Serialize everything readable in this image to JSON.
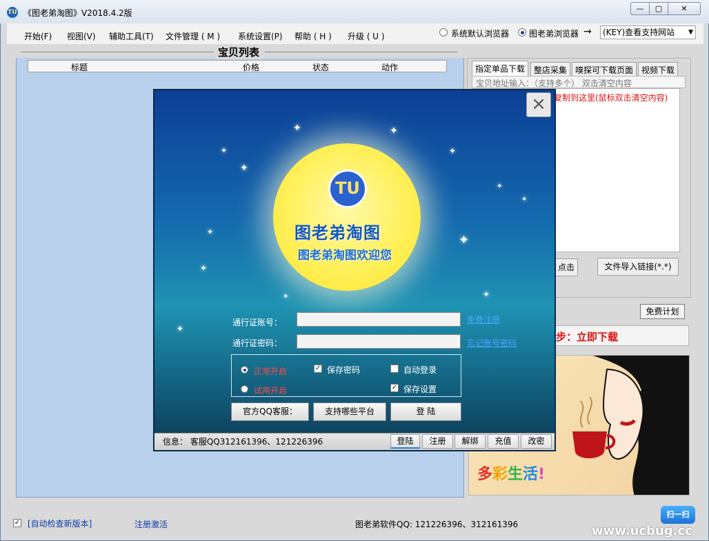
{
  "window": {
    "title": "《图老弟淘图》V2018.4.2版",
    "buttons": {
      "minimize": "—",
      "maximize": "▢",
      "close": "✕"
    }
  },
  "menu": {
    "items": [
      "开始(F)",
      "视图(V)",
      "辅助工具(T)",
      "文件管理 ( M )",
      "系统设置(P)",
      "帮助 ( H )",
      "升级 ( U )"
    ]
  },
  "browser": {
    "option_default": "系统默认浏览器",
    "option_tlds": "图老弟浏览器",
    "selected": "图老弟浏览器",
    "arrow": "→",
    "site_select_value": "(KEY)查看支持网站"
  },
  "list": {
    "title": "宝贝列表",
    "columns": [
      "标题",
      "价格",
      "状态",
      "动作"
    ]
  },
  "right_panel": {
    "tabs": [
      "指定单品下载",
      "整店采集",
      "嗅探可下载页面",
      "视频下载"
    ],
    "active_tab": "指定单品下载",
    "url_input_label": "宝贝地址输入：（支持多个） 双击清空内容",
    "url_hint": "复制到这里(鼠标双击清空内容)",
    "paste_click_label": "点击",
    "import_button": "文件导入链接(*.*)",
    "free_plan_button": "免费计划",
    "step_text": "步：立即下载"
  },
  "ad": {
    "slogan_chars": [
      "多",
      "彩",
      "生",
      "活",
      "!"
    ],
    "slogan_colors": [
      "#e2312a",
      "#f0a400",
      "#32b34a",
      "#1e8be0",
      "#d64ac0"
    ]
  },
  "bottom": {
    "auto_check_label": "[自动检查新版本]",
    "auto_check_checked": true,
    "register_activate": "注册激活",
    "qq_info": "图老弟软件QQ: 121226396、312161396",
    "scan_button": "扫一扫",
    "watermark": "www.ucbug.cc"
  },
  "login_dialog": {
    "close_icon": "×",
    "logo_letters": "TU",
    "logo_text": "图老弟淘图",
    "welcome_text": "图老弟淘图欢迎您",
    "account_label": "通行证账号：",
    "password_label": "通行证密码：",
    "account_value": "",
    "password_value": "",
    "free_register_link": "免费注册",
    "forgot_password_link": "忘记账号密码",
    "mode_normal": "正常开启",
    "mode_trial": "试用开启",
    "mode_selected": "正常开启",
    "save_password": "保存密码",
    "save_password_checked": true,
    "auto_login": "自动登录",
    "auto_login_checked": false,
    "save_settings": "保存设置",
    "save_settings_checked": true,
    "btn_qq_service": "官方QQ客服：",
    "btn_platforms": "支持哪些平台",
    "btn_login": "登  陆",
    "status_info": "信息：  客服QQ312161396、121226396",
    "status_buttons": [
      "登陆",
      "注册",
      "解绑",
      "充值",
      "改密"
    ]
  }
}
